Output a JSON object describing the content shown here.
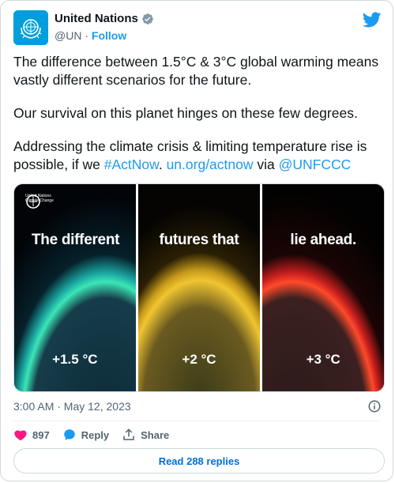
{
  "account": {
    "display_name": "United Nations",
    "handle": "@UN",
    "separator": "·",
    "follow_label": "Follow"
  },
  "tweet": {
    "paragraph1": "The difference between 1.5°C & 3°C global warming means vastly different scenarios for the future.",
    "paragraph2": "Our survival on this planet hinges on these few degrees.",
    "paragraph3_prefix": "Addressing the climate crisis & limiting temperature rise is possible, if we ",
    "hashtag": "#ActNow",
    "period": ". ",
    "link": "un.org/actnow",
    "via": " via ",
    "mention": "@UNFCCC"
  },
  "media": {
    "logo_line1": "United Nations",
    "logo_line2": "Climate Change",
    "panels": [
      {
        "caption": "The different",
        "temp": "+1.5 °C",
        "glow": "#39e0b0"
      },
      {
        "caption": "futures that",
        "temp": "+2 °C",
        "glow": "#f2c531"
      },
      {
        "caption": "lie ahead.",
        "temp": "+3 °C",
        "glow": "#ff3a2a"
      }
    ]
  },
  "meta": {
    "timestamp": "3:00 AM · May 12, 2023"
  },
  "actions": {
    "like_count": "897",
    "reply_label": "Reply",
    "share_label": "Share"
  },
  "replies_button": "Read 288 replies",
  "colors": {
    "accent": "#1d9bf0",
    "like": "#f91880",
    "un_blue": "#009edb"
  }
}
